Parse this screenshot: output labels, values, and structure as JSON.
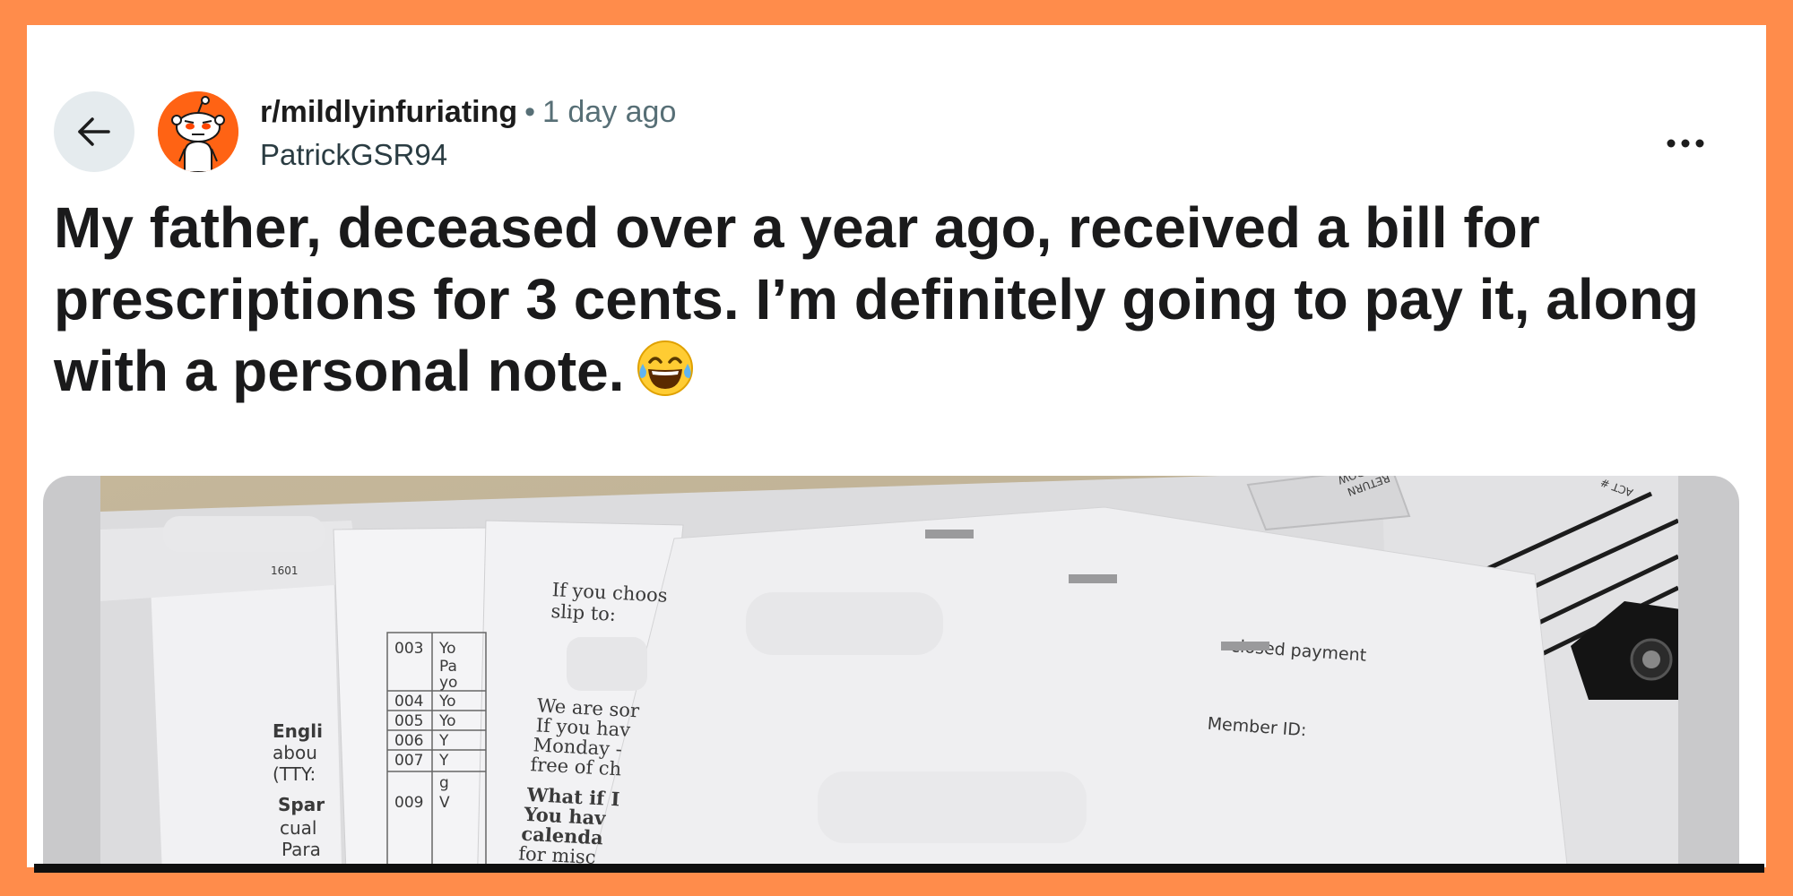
{
  "post": {
    "subreddit": "r/mildlyinfuriating",
    "separator": "•",
    "time_ago": "1 day ago",
    "username": "PatrickGSR94",
    "title": "My father, deceased over a year ago, received a bill for prescriptions for 3 cents. I’m definitely going to pay it, along with a personal note."
  },
  "icons": {
    "back": "arrow-left-icon",
    "more": "more-horizontal-icon",
    "avatar": "reddit-snoo-avatar",
    "emoji": "laughing-tears-emoji"
  },
  "colors": {
    "frame": "#FF8C4B",
    "back_button_bg": "#E5EBEE",
    "avatar_bg": "#FF6314",
    "title_text": "#1A1A1B",
    "meta_text": "#576F76"
  },
  "photo_text": {
    "row_labels": [
      "003",
      "004",
      "005",
      "006",
      "007",
      "009"
    ],
    "row_fragments": [
      "Yo",
      "Yo",
      "Yo",
      "Y",
      "Y",
      "V"
    ],
    "fragment_pa": "Pa",
    "fragment_yo": "yo",
    "fragment_g": "g",
    "left_doc": [
      "Engli",
      "abou",
      "(TTY:",
      "Spar",
      "cual",
      "Para"
    ],
    "mid_doc_top": [
      "If you choos",
      "slip to:"
    ],
    "mid_doc_mid": [
      "We are sor",
      "If you hav",
      "Monday -",
      "free of ch"
    ],
    "mid_doc_bottom": [
      "What if I",
      "You hav",
      "calenda",
      "for misc"
    ],
    "front_doc": [
      "closed payment",
      "Member ID:"
    ],
    "return_window": [
      "RETURN",
      "WINDOW"
    ],
    "corner_label": "ACT #",
    "top_number": "1601"
  }
}
